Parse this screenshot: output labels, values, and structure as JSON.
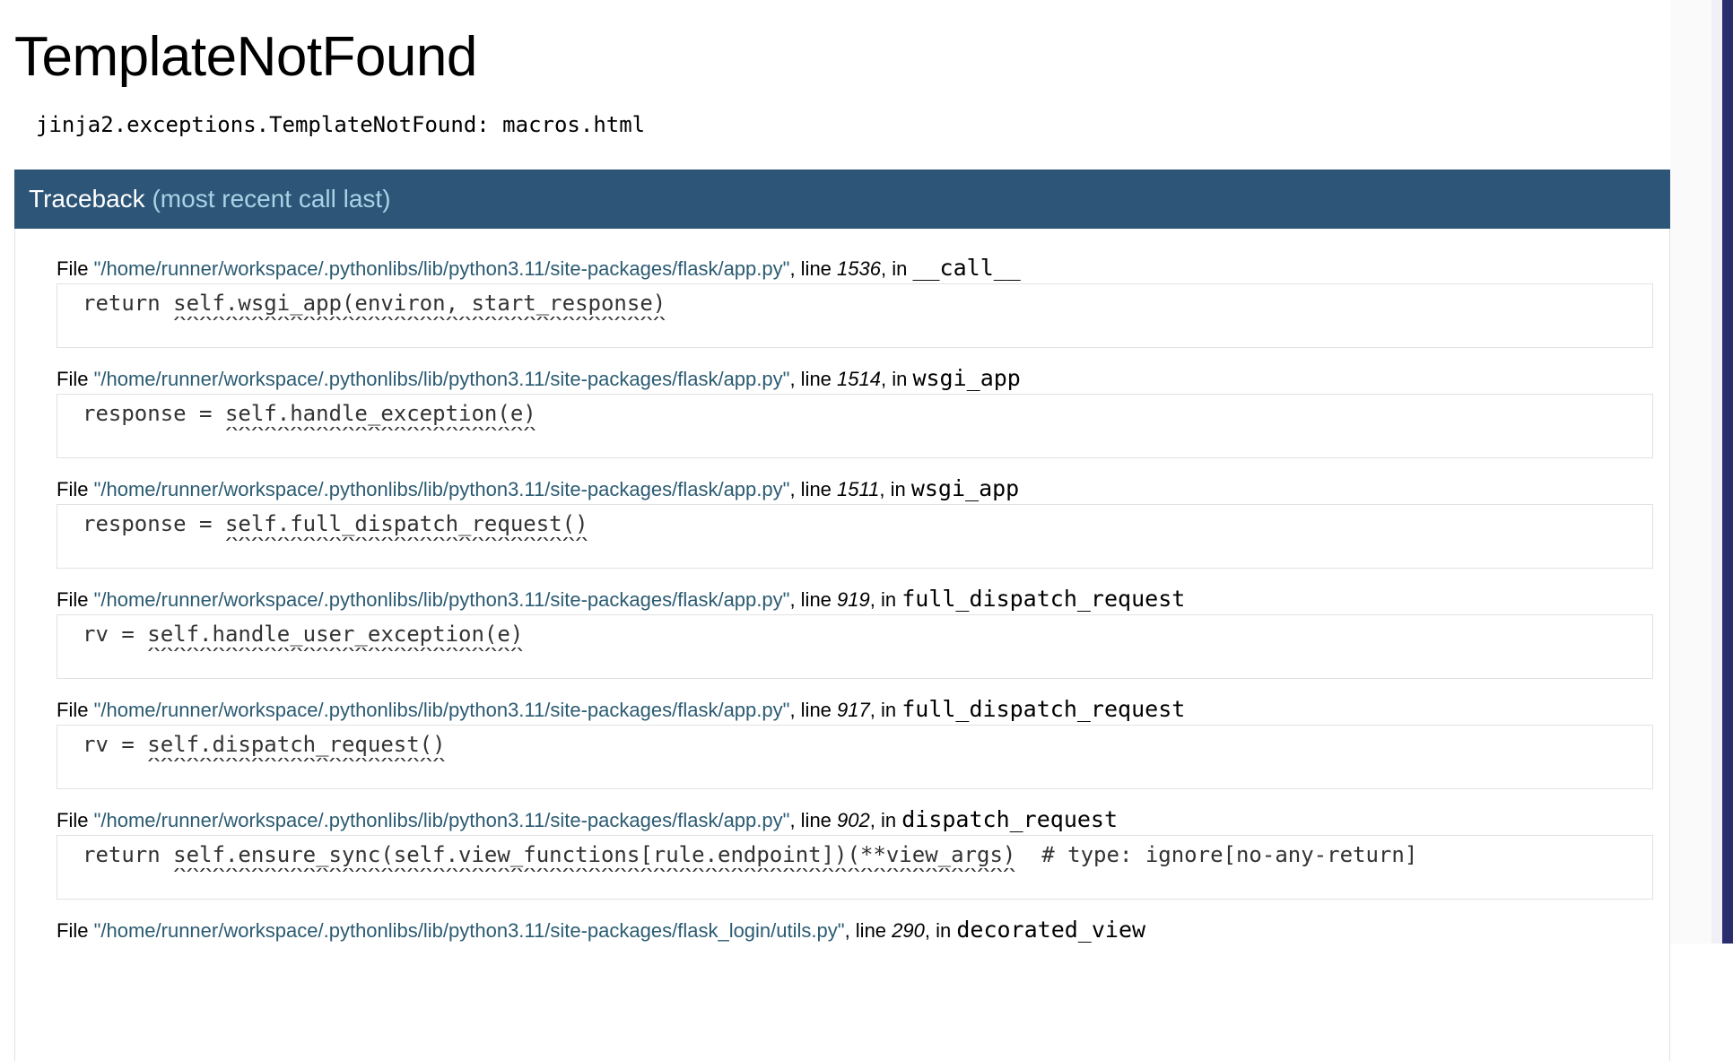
{
  "page": {
    "title": "TemplateNotFound",
    "error_message": "jinja2.exceptions.TemplateNotFound: macros.html"
  },
  "traceback": {
    "heading": "Traceback",
    "subheading": "(most recent call last)"
  },
  "frames": [
    {
      "file": "\"/home/runner/workspace/.pythonlibs/lib/python3.11/site-packages/flask/app.py\"",
      "line": "1536",
      "func": "__call__",
      "code": "return self.wsgi_app(environ, start_response)",
      "carets": "       ^^^^^^^^^^^^^^^^^^^^^^^^^^^^^^^^^^^^^^"
    },
    {
      "file": "\"/home/runner/workspace/.pythonlibs/lib/python3.11/site-packages/flask/app.py\"",
      "line": "1514",
      "func": "wsgi_app",
      "code": "response = self.handle_exception(e)",
      "carets": "           ^^^^^^^^^^^^^^^^^^^^^^^^"
    },
    {
      "file": "\"/home/runner/workspace/.pythonlibs/lib/python3.11/site-packages/flask/app.py\"",
      "line": "1511",
      "func": "wsgi_app",
      "code": "response = self.full_dispatch_request()",
      "carets": "           ^^^^^^^^^^^^^^^^^^^^^^^^^^^^"
    },
    {
      "file": "\"/home/runner/workspace/.pythonlibs/lib/python3.11/site-packages/flask/app.py\"",
      "line": "919",
      "func": "full_dispatch_request",
      "code": "rv = self.handle_user_exception(e)",
      "carets": "     ^^^^^^^^^^^^^^^^^^^^^^^^^^^^^"
    },
    {
      "file": "\"/home/runner/workspace/.pythonlibs/lib/python3.11/site-packages/flask/app.py\"",
      "line": "917",
      "func": "full_dispatch_request",
      "code": "rv = self.dispatch_request()",
      "carets": "     ^^^^^^^^^^^^^^^^^^^^^^^"
    },
    {
      "file": "\"/home/runner/workspace/.pythonlibs/lib/python3.11/site-packages/flask/app.py\"",
      "line": "902",
      "func": "dispatch_request",
      "code": "return self.ensure_sync(self.view_functions[rule.endpoint])(**view_args)  # type: ignore[no-any-return]",
      "carets": "       ^^^^^^^^^^^^^^^^^^^^^^^^^^^^^^^^^^^^^^^^^^^^^^^^^^^^^^^^^^^^^^^^^"
    },
    {
      "file": "\"/home/runner/workspace/.pythonlibs/lib/python3.11/site-packages/flask_login/utils.py\"",
      "line": "290",
      "func": "decorated_view",
      "code": "",
      "carets": ""
    }
  ],
  "labels": {
    "file_word": "File ",
    "line_word": ", line ",
    "in_word": ", in "
  },
  "colors": {
    "traceback_header_bg": "#2c5577",
    "traceback_sub": "#a8d2e6",
    "file_path": "#2b5b72"
  }
}
